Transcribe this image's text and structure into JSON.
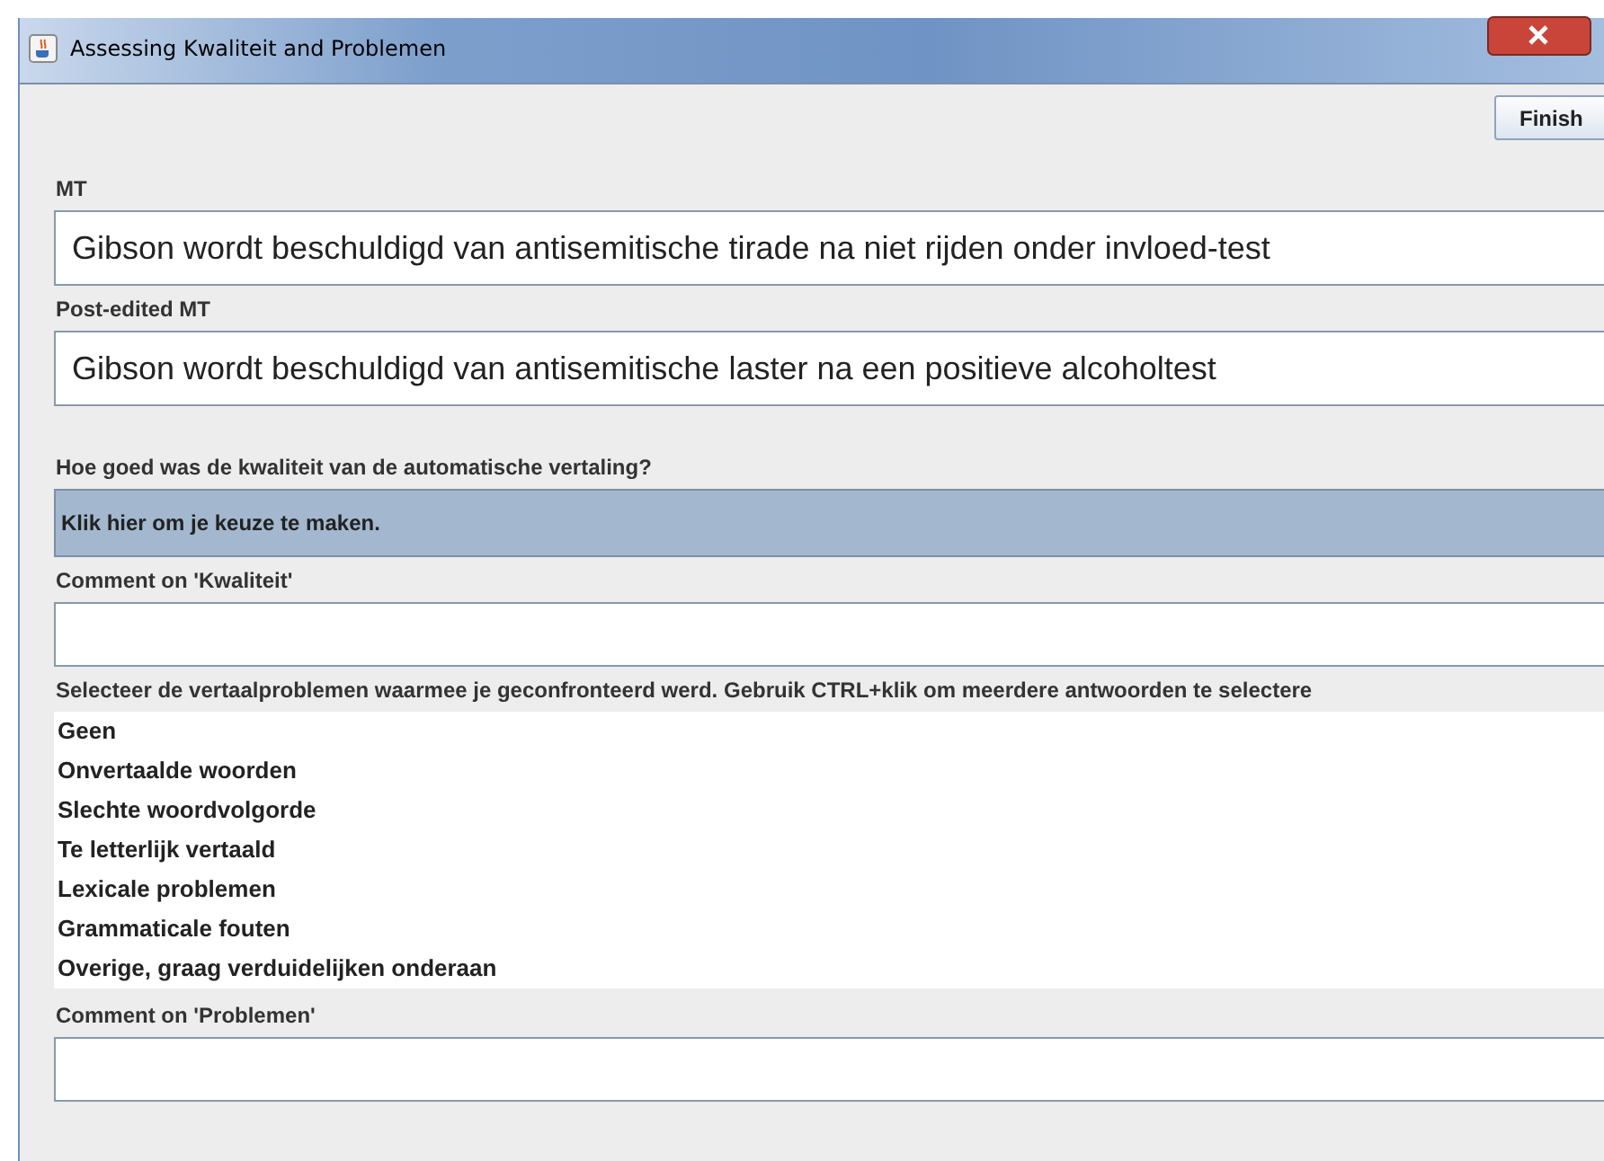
{
  "window": {
    "title": "Assessing Kwaliteit and Problemen"
  },
  "finish_button": "Finish",
  "mt": {
    "label": "MT",
    "value": "Gibson wordt beschuldigd van antisemitische tirade na niet rijden onder invloed-test"
  },
  "post_edited_mt": {
    "label": "Post-edited MT",
    "value": "Gibson wordt beschuldigd van antisemitische laster na een positieve alcoholtest"
  },
  "quality": {
    "label": "Hoe goed was de kwaliteit van de automatische vertaling?",
    "dropdown": "Klik hier om je keuze te maken."
  },
  "quality_comment": {
    "label": "Comment on 'Kwaliteit'"
  },
  "problems": {
    "label": "Selecteer de vertaalproblemen waarmee je geconfronteerd werd. Gebruik CTRL+klik om meerdere antwoorden te selectere",
    "items": [
      {
        "label": "Geen",
        "selected": false
      },
      {
        "label": "Onvertaalde woorden",
        "selected": false
      },
      {
        "label": "Slechte woordvolgorde",
        "selected": false
      },
      {
        "label": "Te letterlijk vertaald",
        "selected": false
      },
      {
        "label": "Lexicale problemen",
        "selected": false
      },
      {
        "label": "Grammaticale fouten",
        "selected": false
      },
      {
        "label": "Overige, graag verduidelijken onderaan",
        "selected": false
      }
    ]
  },
  "problems_comment": {
    "label": "Comment on 'Problemen'"
  }
}
